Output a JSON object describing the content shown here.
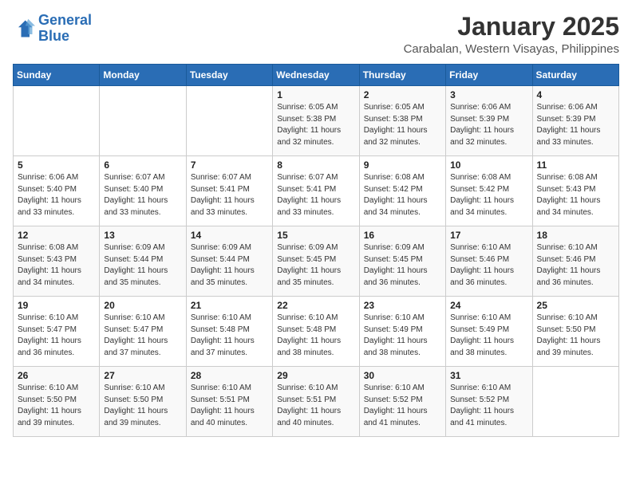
{
  "logo": {
    "line1": "General",
    "line2": "Blue"
  },
  "title": "January 2025",
  "subtitle": "Carabalan, Western Visayas, Philippines",
  "weekdays": [
    "Sunday",
    "Monday",
    "Tuesday",
    "Wednesday",
    "Thursday",
    "Friday",
    "Saturday"
  ],
  "weeks": [
    [
      {
        "day": "",
        "sunrise": "",
        "sunset": "",
        "daylight": ""
      },
      {
        "day": "",
        "sunrise": "",
        "sunset": "",
        "daylight": ""
      },
      {
        "day": "",
        "sunrise": "",
        "sunset": "",
        "daylight": ""
      },
      {
        "day": "1",
        "sunrise": "Sunrise: 6:05 AM",
        "sunset": "Sunset: 5:38 PM",
        "daylight": "Daylight: 11 hours and 32 minutes."
      },
      {
        "day": "2",
        "sunrise": "Sunrise: 6:05 AM",
        "sunset": "Sunset: 5:38 PM",
        "daylight": "Daylight: 11 hours and 32 minutes."
      },
      {
        "day": "3",
        "sunrise": "Sunrise: 6:06 AM",
        "sunset": "Sunset: 5:39 PM",
        "daylight": "Daylight: 11 hours and 32 minutes."
      },
      {
        "day": "4",
        "sunrise": "Sunrise: 6:06 AM",
        "sunset": "Sunset: 5:39 PM",
        "daylight": "Daylight: 11 hours and 33 minutes."
      }
    ],
    [
      {
        "day": "5",
        "sunrise": "Sunrise: 6:06 AM",
        "sunset": "Sunset: 5:40 PM",
        "daylight": "Daylight: 11 hours and 33 minutes."
      },
      {
        "day": "6",
        "sunrise": "Sunrise: 6:07 AM",
        "sunset": "Sunset: 5:40 PM",
        "daylight": "Daylight: 11 hours and 33 minutes."
      },
      {
        "day": "7",
        "sunrise": "Sunrise: 6:07 AM",
        "sunset": "Sunset: 5:41 PM",
        "daylight": "Daylight: 11 hours and 33 minutes."
      },
      {
        "day": "8",
        "sunrise": "Sunrise: 6:07 AM",
        "sunset": "Sunset: 5:41 PM",
        "daylight": "Daylight: 11 hours and 33 minutes."
      },
      {
        "day": "9",
        "sunrise": "Sunrise: 6:08 AM",
        "sunset": "Sunset: 5:42 PM",
        "daylight": "Daylight: 11 hours and 34 minutes."
      },
      {
        "day": "10",
        "sunrise": "Sunrise: 6:08 AM",
        "sunset": "Sunset: 5:42 PM",
        "daylight": "Daylight: 11 hours and 34 minutes."
      },
      {
        "day": "11",
        "sunrise": "Sunrise: 6:08 AM",
        "sunset": "Sunset: 5:43 PM",
        "daylight": "Daylight: 11 hours and 34 minutes."
      }
    ],
    [
      {
        "day": "12",
        "sunrise": "Sunrise: 6:08 AM",
        "sunset": "Sunset: 5:43 PM",
        "daylight": "Daylight: 11 hours and 34 minutes."
      },
      {
        "day": "13",
        "sunrise": "Sunrise: 6:09 AM",
        "sunset": "Sunset: 5:44 PM",
        "daylight": "Daylight: 11 hours and 35 minutes."
      },
      {
        "day": "14",
        "sunrise": "Sunrise: 6:09 AM",
        "sunset": "Sunset: 5:44 PM",
        "daylight": "Daylight: 11 hours and 35 minutes."
      },
      {
        "day": "15",
        "sunrise": "Sunrise: 6:09 AM",
        "sunset": "Sunset: 5:45 PM",
        "daylight": "Daylight: 11 hours and 35 minutes."
      },
      {
        "day": "16",
        "sunrise": "Sunrise: 6:09 AM",
        "sunset": "Sunset: 5:45 PM",
        "daylight": "Daylight: 11 hours and 36 minutes."
      },
      {
        "day": "17",
        "sunrise": "Sunrise: 6:10 AM",
        "sunset": "Sunset: 5:46 PM",
        "daylight": "Daylight: 11 hours and 36 minutes."
      },
      {
        "day": "18",
        "sunrise": "Sunrise: 6:10 AM",
        "sunset": "Sunset: 5:46 PM",
        "daylight": "Daylight: 11 hours and 36 minutes."
      }
    ],
    [
      {
        "day": "19",
        "sunrise": "Sunrise: 6:10 AM",
        "sunset": "Sunset: 5:47 PM",
        "daylight": "Daylight: 11 hours and 36 minutes."
      },
      {
        "day": "20",
        "sunrise": "Sunrise: 6:10 AM",
        "sunset": "Sunset: 5:47 PM",
        "daylight": "Daylight: 11 hours and 37 minutes."
      },
      {
        "day": "21",
        "sunrise": "Sunrise: 6:10 AM",
        "sunset": "Sunset: 5:48 PM",
        "daylight": "Daylight: 11 hours and 37 minutes."
      },
      {
        "day": "22",
        "sunrise": "Sunrise: 6:10 AM",
        "sunset": "Sunset: 5:48 PM",
        "daylight": "Daylight: 11 hours and 38 minutes."
      },
      {
        "day": "23",
        "sunrise": "Sunrise: 6:10 AM",
        "sunset": "Sunset: 5:49 PM",
        "daylight": "Daylight: 11 hours and 38 minutes."
      },
      {
        "day": "24",
        "sunrise": "Sunrise: 6:10 AM",
        "sunset": "Sunset: 5:49 PM",
        "daylight": "Daylight: 11 hours and 38 minutes."
      },
      {
        "day": "25",
        "sunrise": "Sunrise: 6:10 AM",
        "sunset": "Sunset: 5:50 PM",
        "daylight": "Daylight: 11 hours and 39 minutes."
      }
    ],
    [
      {
        "day": "26",
        "sunrise": "Sunrise: 6:10 AM",
        "sunset": "Sunset: 5:50 PM",
        "daylight": "Daylight: 11 hours and 39 minutes."
      },
      {
        "day": "27",
        "sunrise": "Sunrise: 6:10 AM",
        "sunset": "Sunset: 5:50 PM",
        "daylight": "Daylight: 11 hours and 39 minutes."
      },
      {
        "day": "28",
        "sunrise": "Sunrise: 6:10 AM",
        "sunset": "Sunset: 5:51 PM",
        "daylight": "Daylight: 11 hours and 40 minutes."
      },
      {
        "day": "29",
        "sunrise": "Sunrise: 6:10 AM",
        "sunset": "Sunset: 5:51 PM",
        "daylight": "Daylight: 11 hours and 40 minutes."
      },
      {
        "day": "30",
        "sunrise": "Sunrise: 6:10 AM",
        "sunset": "Sunset: 5:52 PM",
        "daylight": "Daylight: 11 hours and 41 minutes."
      },
      {
        "day": "31",
        "sunrise": "Sunrise: 6:10 AM",
        "sunset": "Sunset: 5:52 PM",
        "daylight": "Daylight: 11 hours and 41 minutes."
      },
      {
        "day": "",
        "sunrise": "",
        "sunset": "",
        "daylight": ""
      }
    ]
  ]
}
